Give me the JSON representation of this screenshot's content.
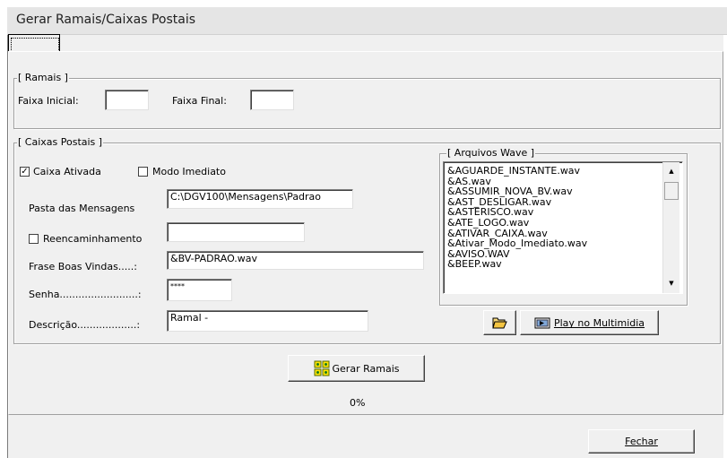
{
  "window": {
    "title": "Gerar Ramais/Caixas Postais"
  },
  "ramais": {
    "group_label": "[ Ramais ]",
    "faixa_inicial_label": "Faixa Inicial:",
    "faixa_inicial_value": "",
    "faixa_final_label": "Faixa Final:",
    "faixa_final_value": ""
  },
  "caixas": {
    "group_label": "[ Caixas Postais ]",
    "caixa_ativada_label": "Caixa Ativada",
    "caixa_ativada_checked": true,
    "modo_imediato_label": "Modo Imediato",
    "modo_imediato_checked": false,
    "pasta_label": "Pasta das Mensagens",
    "pasta_value": "C:\\DGV100\\Mensagens\\Padrao",
    "reencaminhamento_label": "Reencaminhamento",
    "reencaminhamento_checked": false,
    "reencaminhamento_value": "",
    "frase_label": "Frase Boas Vindas.....:",
    "frase_value": "&BV-PADRAO.wav",
    "senha_label": "Senha.........................:",
    "senha_value": "****",
    "descricao_label": "Descrição...................:",
    "descricao_value": "Ramal -"
  },
  "arquivos": {
    "group_label": "[ Arquivos Wave ]",
    "items": [
      "&AGUARDE_INSTANTE.wav",
      "&AS.wav",
      "&ASSUMIR_NOVA_BV.wav",
      "&AST_DESLIGAR.wav",
      "&ASTERISCO.wav",
      "&ATE_LOGO.wav",
      "&ATIVAR_CAIXA.wav",
      "&Ativar_Modo_Imediato.wav",
      "&AVISO.WAV",
      "&BEEP.wav"
    ],
    "play_label": "Play no Multimidia"
  },
  "actions": {
    "gerar_label": "Gerar Ramais",
    "progress_text": "0%",
    "progress_value": 0,
    "fechar_label": "Fechar"
  }
}
